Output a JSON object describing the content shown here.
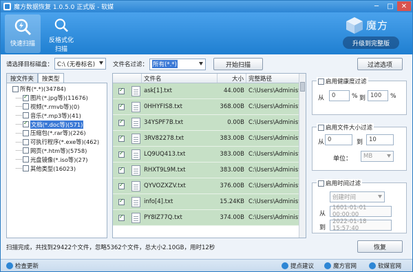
{
  "window": {
    "title": "魔方数据恢复 1.0.5.0 正式版 - 软媒"
  },
  "toolbar": {
    "quick_scan": "快速扫描",
    "format_scan_line1": "反格式化",
    "format_scan_line2": "扫描",
    "brand": "魔方",
    "upgrade": "升级到完整版"
  },
  "disk": {
    "label": "请选择目标磁盘：",
    "value": "C:\\ (无卷标名)"
  },
  "filter": {
    "label": "文件名过滤：",
    "value": "所有(*.*)",
    "start_scan": "开始扫描",
    "options": "过滤选项"
  },
  "left_tabs": [
    "按文件夹",
    "按类型"
  ],
  "tree": [
    {
      "text": "所有(*.*)(34784)",
      "level": 0,
      "checked": false,
      "hl": false
    },
    {
      "text": "图片(*.jpg等)(11676)",
      "level": 1,
      "checked": true,
      "hl": false
    },
    {
      "text": "视频(*.rmvb等)(0)",
      "level": 1,
      "checked": false,
      "hl": false
    },
    {
      "text": "音乐(*.mp3等)(41)",
      "level": 1,
      "checked": false,
      "hl": false
    },
    {
      "text": "文档(*.doc等)(571)",
      "level": 1,
      "checked": true,
      "hl": true
    },
    {
      "text": "压缩包(*.rar等)(226)",
      "level": 1,
      "checked": false,
      "hl": false
    },
    {
      "text": "可执行程序(*.exe等)(462)",
      "level": 1,
      "checked": false,
      "hl": false
    },
    {
      "text": "网页(*.htm等)(5758)",
      "level": 1,
      "checked": false,
      "hl": false
    },
    {
      "text": "光盘镜像(*.iso等)(27)",
      "level": 1,
      "checked": false,
      "hl": false
    },
    {
      "text": "其他类型(16023)",
      "level": 1,
      "checked": false,
      "hl": false
    }
  ],
  "table": {
    "headers": [
      "文件名",
      "大小",
      "完整路径"
    ],
    "rows": [
      {
        "name": "ask[1].txt",
        "size": "44.00B",
        "path": "C:\\Users\\Administ"
      },
      {
        "name": "0HHYFIS8.txt",
        "size": "368.00B",
        "path": "C:\\Users\\Administ"
      },
      {
        "name": "34YSPF7B.txt",
        "size": "0.00B",
        "path": "C:\\Users\\Administ"
      },
      {
        "name": "3RV82278.txt",
        "size": "383.00B",
        "path": "C:\\Users\\Administ"
      },
      {
        "name": "LQ9UQ413.txt",
        "size": "383.00B",
        "path": "C:\\Users\\Administ"
      },
      {
        "name": "RHXT9L9M.txt",
        "size": "383.00B",
        "path": "C:\\Users\\Administ"
      },
      {
        "name": "QYVOZXZV.txt",
        "size": "376.00B",
        "path": "C:\\Users\\Administ"
      },
      {
        "name": "info[4].txt",
        "size": "15.24KB",
        "path": "C:\\Users\\Administ"
      },
      {
        "name": "PY8IZ77Q.txt",
        "size": "374.00B",
        "path": "C:\\Users\\Administ"
      }
    ]
  },
  "health_filter": {
    "title": "启用健康度过滤",
    "from": "从",
    "from_val": "0",
    "pct": "%",
    "to": "到",
    "to_val": "100",
    "pct2": "%"
  },
  "size_filter": {
    "title": "启用文件大小过滤",
    "from": "从",
    "from_val": "0",
    "to": "到",
    "to_val": "10",
    "unit_label": "单位：",
    "unit": "MB"
  },
  "time_filter": {
    "title": "启用时间过滤",
    "mode": "创建时间",
    "from": "从",
    "from_val": "1601-01-01 00:00:00",
    "to": "到",
    "to_val": "2022-01-18 15:57:40"
  },
  "restore": "恢复",
  "status": "扫描完成，共找到29422个文件，忽略5362个文件，总大小2.10GB，用时12秒",
  "bottom": {
    "check_update": "检查更新",
    "suggest": "提点建议",
    "official": "魔方官网",
    "ruanmei": "软媒官网"
  }
}
